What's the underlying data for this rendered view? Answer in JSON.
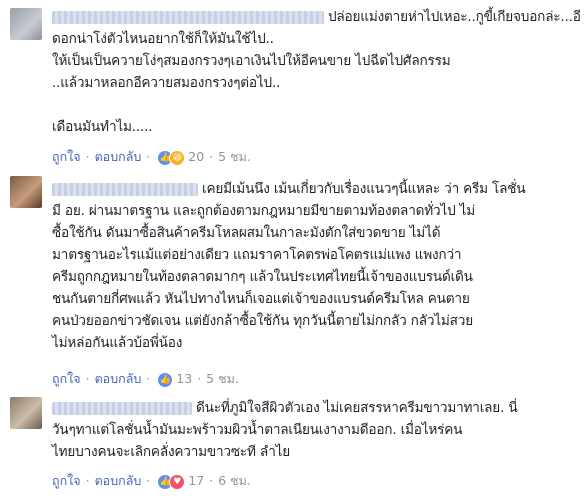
{
  "comments": [
    {
      "lines": [
        "ปล่อยแม่งตายห่าไปเหอะ..กูขี้เกียจบอกล่ะ...อี",
        "ดอกน่าโง่ตัวไหนอยากใช้ก็ให้มันใช้ไป..",
        "ให้เป็นเป็นควายโง่ๆสมองกรวงๆเอาเงินไปให้อีคนขาย ไปฉีดไปศัลกรรม",
        "..แล้วมาหลอกอีควายสมองกรวงๆต่อไป..",
        "เดือนมันทำไม....."
      ],
      "actions": {
        "like": "ถูกใจ",
        "reply": "ตอบกลับ",
        "reactions": [
          "like",
          "haha"
        ],
        "count": "20",
        "time": "5 ชม."
      }
    },
    {
      "lines": [
        "เคยมีเม้นนึง เม้นเกี่ยวกับเรื่องแนวๆนี้แหละ ว่า ครีม โลชั่น",
        "มี อย. ผ่านมาตรฐาน และถูกต้องตามกฎหมายมีขายตามท้องตลาดทั่วไป ไม่",
        "ซื้อใช้กัน ดันมาซื้อสินค้าครีมโหลผสมในกาละมังตักใส่ขวดขาย ไม่ได้",
        "มาตรฐานอะไรแม้แต่อย่างเดียว แถมราคาโคตรพ่อโคตรแม่แพง แพงกว่า",
        "ครีมถูกกฎหมายในท้องตลาดมากๆ แล้วในประเทศไทยนี้เจ้าของแบรนด์เดิน",
        "ชนกันตายกี่ศพแล้ว หันไปทางไหนก็เจอแต่เจ้าของแบรนด์ครีมโหล คนตาย",
        "คนป่วยออกข่าวชัดเจน แต่ยังกล้าซื้อใช้กัน ทุกวันนี้ตายไม่กกลัว กลัวไม่สวย",
        "ไม่หล่อกันแล้วบ้อพี่น้อง"
      ],
      "actions": {
        "like": "ถูกใจ",
        "reply": "ตอบกลับ",
        "reactions": [
          "like"
        ],
        "count": "13",
        "time": "5 ชม."
      }
    },
    {
      "lines": [
        "ดีนะที่ภูมิใจสีผิวตัวเอง ไม่เคยสรรหาครีมขาวมาทาเลย. นี่",
        "วันๆทาแต่โลชั่นน้ำมันมะพร้าวมผิวน้ำตาลเนียนเงางามดีออก. เมื่อไหร่คน",
        "ไทยบางคนจะเลิกคลั่งความขาวซะที ลำไย"
      ],
      "actions": {
        "like": "ถูกใจ",
        "reply": "ตอบกลับ",
        "reactions": [
          "like",
          "love"
        ],
        "count": "17",
        "time": "6 ชม."
      }
    }
  ]
}
